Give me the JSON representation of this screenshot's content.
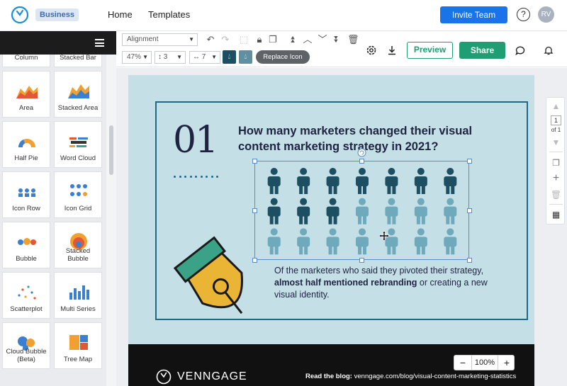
{
  "nav": {
    "badge": "Business",
    "home": "Home",
    "templates": "Templates",
    "invite": "Invite Team",
    "help": "?",
    "avatar": "RV"
  },
  "sidebar": {
    "tiles": [
      {
        "label": "Stacked Column",
        "icon": "stacked-column-icon"
      },
      {
        "label": "Stacked Bar",
        "icon": "stacked-bar-icon"
      },
      {
        "label": "Area",
        "icon": "area-chart-icon"
      },
      {
        "label": "Stacked Area",
        "icon": "stacked-area-icon"
      },
      {
        "label": "Half Pie",
        "icon": "half-pie-icon"
      },
      {
        "label": "Word Cloud",
        "icon": "word-cloud-icon"
      },
      {
        "label": "Icon Row",
        "icon": "icon-row-icon"
      },
      {
        "label": "Icon Grid",
        "icon": "icon-grid-icon"
      },
      {
        "label": "Bubble",
        "icon": "bubble-icon"
      },
      {
        "label": "Stacked Bubble",
        "icon": "stacked-bubble-icon"
      },
      {
        "label": "Scatterplot",
        "icon": "scatterplot-icon"
      },
      {
        "label": "Multi Series",
        "icon": "multi-series-icon"
      },
      {
        "label": "Cloud Bubble (Beta)",
        "icon": "cloud-bubble-icon"
      },
      {
        "label": "Tree Map",
        "icon": "tree-map-icon"
      }
    ]
  },
  "toolbar": {
    "alignment": "Alignment",
    "zoom_select": "47%",
    "line_height": "3",
    "letter_spacing": "7",
    "replace_icon": "Replace Icon",
    "preview": "Preview",
    "share": "Share",
    "colors": {
      "swatch1": "#1d4f63",
      "swatch2": "#5f8fa0",
      "accent": "#1e9e72"
    }
  },
  "canvas": {
    "number": "01",
    "question": "How many marketers changed their visual content marketing strategy in 2021?",
    "body_pre": "Of the marketers who said they pivoted their strategy, ",
    "body_bold": "almost half mentioned rebranding",
    "body_post": " or creating a new visual identity.",
    "icon_grid": {
      "rows": 3,
      "cols": 7,
      "filled": 10,
      "color_dark": "#1d4f63",
      "color_light": "#6fa9bc"
    },
    "brand": "VENNGAGE",
    "blog_label": "Read the blog:",
    "blog_url": " venngage.com/blog/visual-content-marketing-statistics"
  },
  "zoom": {
    "minus": "−",
    "value": "100%",
    "plus": "+"
  },
  "rail": {
    "page": "1",
    "of": "of 1"
  }
}
